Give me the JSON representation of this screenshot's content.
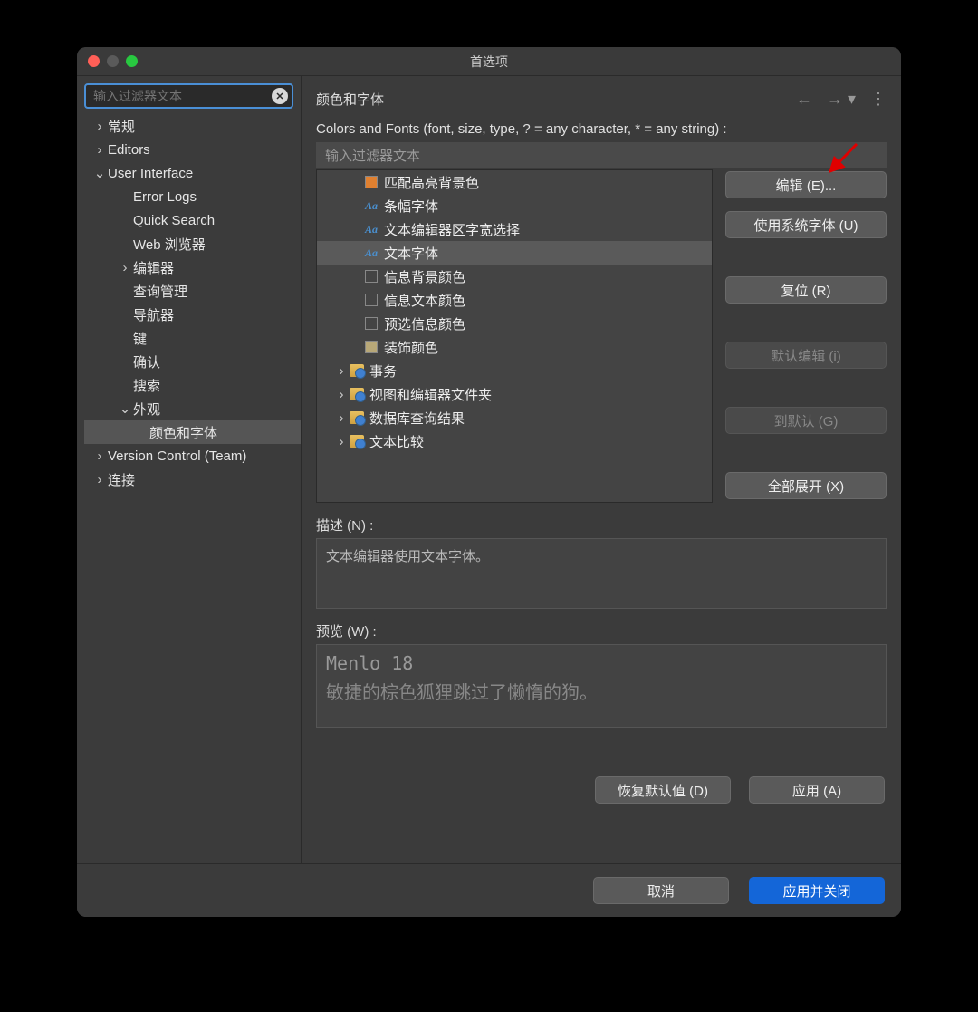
{
  "window": {
    "title": "首选项"
  },
  "sidebar": {
    "search_placeholder": "输入过滤器文本",
    "items": [
      {
        "label": "常规",
        "chev": ">",
        "ind": 0
      },
      {
        "label": "Editors",
        "chev": ">",
        "ind": 0
      },
      {
        "label": "User Interface",
        "chev": "v",
        "ind": 0
      },
      {
        "label": "Error Logs",
        "chev": "",
        "ind": 1
      },
      {
        "label": "Quick Search",
        "chev": "",
        "ind": 1
      },
      {
        "label": "Web 浏览器",
        "chev": "",
        "ind": 1
      },
      {
        "label": "编辑器",
        "chev": ">",
        "ind": 1
      },
      {
        "label": "查询管理",
        "chev": "",
        "ind": 1
      },
      {
        "label": "导航器",
        "chev": "",
        "ind": 1
      },
      {
        "label": "键",
        "chev": "",
        "ind": 1
      },
      {
        "label": "确认",
        "chev": "",
        "ind": 1
      },
      {
        "label": "搜索",
        "chev": "",
        "ind": 1
      },
      {
        "label": "外观",
        "chev": "v",
        "ind": 1
      },
      {
        "label": "颜色和字体",
        "chev": "",
        "ind": 2,
        "sel": true
      },
      {
        "label": "Version Control (Team)",
        "chev": ">",
        "ind": 0
      },
      {
        "label": "连接",
        "chev": ">",
        "ind": 0
      }
    ]
  },
  "content": {
    "heading": "颜色和字体",
    "subline": "Colors and Fonts (font, size, type, ? = any character, * = any string) :",
    "filter_placeholder": "输入过滤器文本",
    "list": [
      {
        "label": "匹配高亮背景色",
        "icon": "sw-orange",
        "pl": 1
      },
      {
        "label": "条幅字体",
        "icon": "aa",
        "pl": 1
      },
      {
        "label": "文本编辑器区字宽选择",
        "icon": "aa",
        "pl": 1
      },
      {
        "label": "文本字体",
        "icon": "aa",
        "pl": 1,
        "sel": true
      },
      {
        "label": "信息背景颜色",
        "icon": "sw-empty",
        "pl": 1
      },
      {
        "label": "信息文本颜色",
        "icon": "sw-empty",
        "pl": 1
      },
      {
        "label": "预选信息颜色",
        "icon": "sw-empty",
        "pl": 1
      },
      {
        "label": "装饰颜色",
        "icon": "sw-tan",
        "pl": 1
      },
      {
        "label": "事务",
        "icon": "folder",
        "pl": 0,
        "chev": ">"
      },
      {
        "label": "视图和编辑器文件夹",
        "icon": "folder",
        "pl": 0,
        "chev": ">"
      },
      {
        "label": "数据库查询结果",
        "icon": "folder",
        "pl": 0,
        "chev": ">"
      },
      {
        "label": "文本比较",
        "icon": "folder",
        "pl": 0,
        "chev": ">"
      }
    ],
    "buttons": {
      "edit": "编辑 (E)...",
      "use_system": "使用系统字体 (U)",
      "reset": "复位 (R)",
      "default_edit": "默认编辑   (i)",
      "to_default": "到默认 (G)",
      "expand_all": "全部展开 (X)"
    },
    "desc_label": "描述 (N) :",
    "desc_text": "文本编辑器使用文本字体。",
    "preview_label": "预览 (W) :",
    "preview_font": "Menlo 18",
    "preview_text": "敏捷的棕色狐狸跳过了懒惰的狗。",
    "restore_defaults": "恢复默认值 (D)",
    "apply": "应用 (A)"
  },
  "footer": {
    "cancel": "取消",
    "apply_close": "应用并关闭"
  }
}
